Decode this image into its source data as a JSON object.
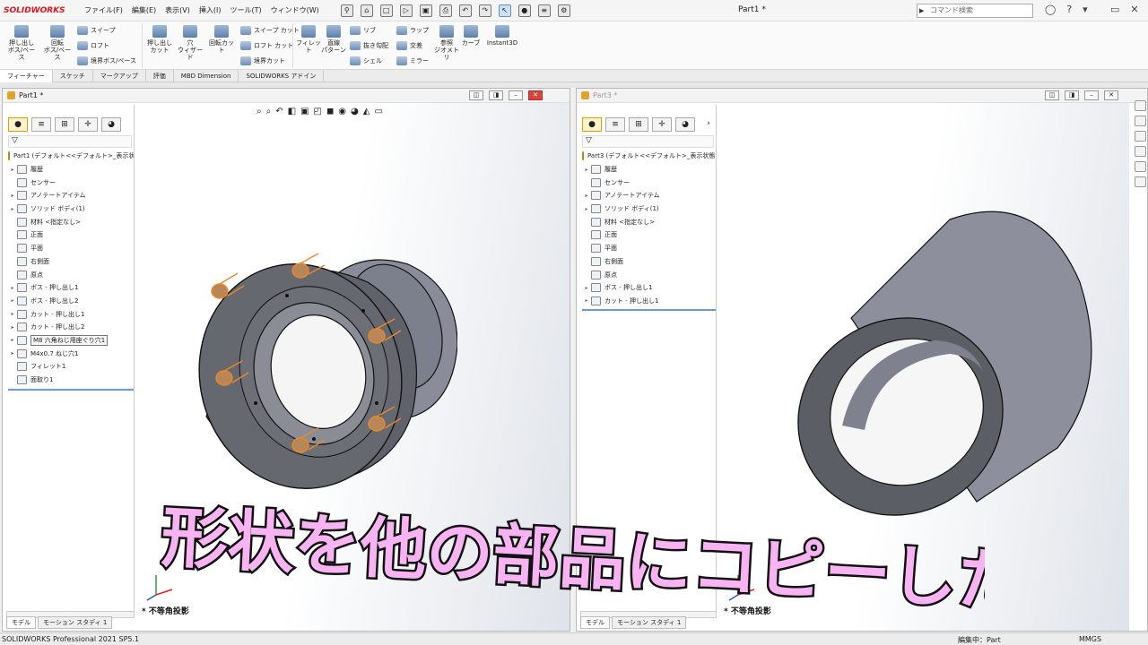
{
  "app": {
    "logo": "SOLIDWORKS",
    "doc_title": "Part1 *"
  },
  "menu": [
    "ファイル(F)",
    "編集(E)",
    "表示(V)",
    "挿入(I)",
    "ツール(T)",
    "ウィンドウ(W)"
  ],
  "search": {
    "placeholder": "コマンド検索"
  },
  "ribbon": {
    "extrude_boss": "押し出し\nボス/ベース",
    "revolve_boss": "回転\nボス/ベース",
    "sweep": "スイープ",
    "loft": "ロフト",
    "boundary_boss": "境界ボス/ベース",
    "extrude_cut": "押し出し\nカット",
    "hole_wizard": "穴\nウィザード",
    "revolve_cut": "回転カット",
    "sweep_cut": "スイープ カット",
    "loft_cut": "ロフト カット",
    "boundary_cut": "境界カット",
    "fillet": "フィレット",
    "linear_pattern": "直線\nパターン",
    "rib": "リブ",
    "draft": "抜き勾配",
    "shell": "シェル",
    "wrap": "ラップ",
    "intersect": "交差",
    "mirror": "ミラー",
    "ref_geometry": "参照\nジオメトリ",
    "curves": "カーブ",
    "instant3d": "Instant3D"
  },
  "tabs": [
    "フィーチャー",
    "スケッチ",
    "マークアップ",
    "評価",
    "MBD Dimension",
    "SOLIDWORKS アドイン"
  ],
  "left_doc": {
    "name": "Part1 *",
    "tree": [
      {
        "label": "Part1 (デフォルト<<デフォルト>_表示状態",
        "root": true
      },
      {
        "label": "履歴",
        "caret": true
      },
      {
        "label": "センサー"
      },
      {
        "label": "アノテートアイテム",
        "caret": true
      },
      {
        "label": "ソリッド ボディ(1)",
        "caret": true
      },
      {
        "label": "材料 <指定なし>"
      },
      {
        "label": "正面"
      },
      {
        "label": "平面"
      },
      {
        "label": "右側面"
      },
      {
        "label": "原点"
      },
      {
        "label": "ボス - 押し出し1",
        "caret": true
      },
      {
        "label": "ボス - 押し出し2",
        "caret": true
      },
      {
        "label": "カット - 押し出し1",
        "caret": true
      },
      {
        "label": "カット - 押し出し2",
        "caret": true
      },
      {
        "label": "M8 六角ねじ用座ぐり穴1",
        "caret": true,
        "highlight": true
      },
      {
        "label": "M4x0.7 ねじ穴1",
        "caret": true
      },
      {
        "label": "フィレット1"
      },
      {
        "label": "面取り1"
      }
    ],
    "projection": "不等角投影",
    "bottom_tabs": [
      "モデル",
      "モーション スタディ 1"
    ]
  },
  "right_doc": {
    "name": "Part3 *",
    "tree": [
      {
        "label": "Part3 (デフォルト<<デフォルト>_表示状態 1>",
        "root": true
      },
      {
        "label": "履歴",
        "caret": true
      },
      {
        "label": "センサー"
      },
      {
        "label": "アノテートアイテム",
        "caret": true
      },
      {
        "label": "ソリッド ボディ(1)",
        "caret": true
      },
      {
        "label": "材料 <指定なし>"
      },
      {
        "label": "正面"
      },
      {
        "label": "平面"
      },
      {
        "label": "右側面"
      },
      {
        "label": "原点"
      },
      {
        "label": "ボス - 押し出し1",
        "caret": true
      },
      {
        "label": "カット - 押し出し1",
        "caret": true
      }
    ],
    "projection": "不等角投影",
    "bottom_tabs": [
      "モデル",
      "モーション スタディ 1"
    ]
  },
  "status": {
    "product": "SOLIDWORKS Professional 2021 SP5.1",
    "editing": "編集中：Part",
    "units": "MMGS"
  },
  "caption": "形状を他の部品にコピーしたい",
  "colors": {
    "caption_fill": "#f7b3f2",
    "caption_stroke": "#111111",
    "hole_highlight": "#e8892b",
    "body": "#6c6e78"
  }
}
